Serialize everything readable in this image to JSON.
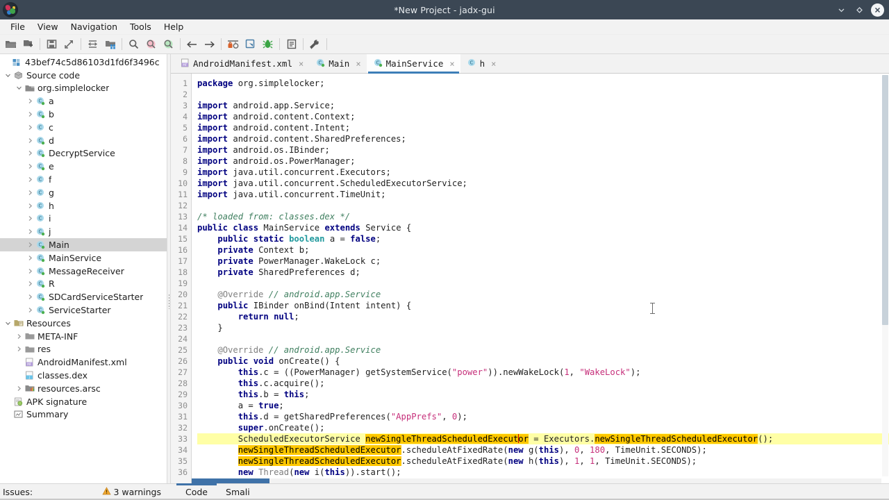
{
  "window": {
    "title": "*New Project - jadx-gui",
    "logo_icon": "jadx-logo-icon",
    "minimize_icon": "chevron-down-icon",
    "maximize_icon": "diamond-icon",
    "close_icon": "close-icon"
  },
  "menubar": {
    "items": [
      {
        "label": "File"
      },
      {
        "label": "View"
      },
      {
        "label": "Navigation"
      },
      {
        "label": "Tools"
      },
      {
        "label": "Help"
      }
    ]
  },
  "toolbar": {
    "items": [
      {
        "name": "open-file-icon",
        "title": "Open file"
      },
      {
        "name": "add-files-icon",
        "title": "Add files"
      },
      {
        "name": "save-all-icon",
        "title": "Save all"
      },
      {
        "name": "export-gradle-icon",
        "title": "Export gradle project"
      },
      {
        "name": "sync-icon",
        "title": "Sync"
      },
      {
        "name": "flat-packages-icon",
        "title": "Flat packages"
      },
      {
        "name": "search-icon",
        "title": "Search text"
      },
      {
        "name": "find-class-icon",
        "title": "Search class"
      },
      {
        "name": "find-comment-icon",
        "title": "Search comment"
      },
      {
        "name": "back-arrow-icon",
        "title": "Back"
      },
      {
        "name": "forward-arrow-icon",
        "title": "Forward"
      },
      {
        "name": "deobfuscation-icon",
        "title": "Deobfuscation"
      },
      {
        "name": "quark-icon",
        "title": "Quark engine"
      },
      {
        "name": "debugger-icon",
        "title": "Debugger"
      },
      {
        "name": "log-viewer-icon",
        "title": "Log viewer"
      },
      {
        "name": "preferences-icon",
        "title": "Preferences"
      }
    ]
  },
  "sidebar": {
    "tree": [
      {
        "depth": 0,
        "twisty": "none",
        "icon": "apk-icon",
        "label": "43bef74c5d86103d1fd6f3496c"
      },
      {
        "depth": 0,
        "twisty": "open",
        "icon": "package-icon",
        "label": "Source code"
      },
      {
        "depth": 1,
        "twisty": "open",
        "icon": "folder-icon",
        "label": "org.simplelocker"
      },
      {
        "depth": 2,
        "twisty": "closed",
        "icon": "class-icon",
        "label": "a"
      },
      {
        "depth": 2,
        "twisty": "closed",
        "icon": "class-icon",
        "label": "b"
      },
      {
        "depth": 2,
        "twisty": "closed",
        "icon": "class-plain-icon",
        "label": "c"
      },
      {
        "depth": 2,
        "twisty": "closed",
        "icon": "class-icon",
        "label": "d"
      },
      {
        "depth": 2,
        "twisty": "closed",
        "icon": "class-icon",
        "label": "DecryptService"
      },
      {
        "depth": 2,
        "twisty": "closed",
        "icon": "class-icon",
        "label": "e"
      },
      {
        "depth": 2,
        "twisty": "closed",
        "icon": "class-plain-icon",
        "label": "f"
      },
      {
        "depth": 2,
        "twisty": "closed",
        "icon": "class-plain-icon",
        "label": "g"
      },
      {
        "depth": 2,
        "twisty": "closed",
        "icon": "class-plain-icon",
        "label": "h"
      },
      {
        "depth": 2,
        "twisty": "closed",
        "icon": "class-plain-icon",
        "label": "i"
      },
      {
        "depth": 2,
        "twisty": "closed",
        "icon": "class-icon",
        "label": "j"
      },
      {
        "depth": 2,
        "twisty": "closed",
        "icon": "class-icon",
        "label": "Main",
        "selected": true
      },
      {
        "depth": 2,
        "twisty": "closed",
        "icon": "class-icon",
        "label": "MainService"
      },
      {
        "depth": 2,
        "twisty": "closed",
        "icon": "class-icon",
        "label": "MessageReceiver"
      },
      {
        "depth": 2,
        "twisty": "closed",
        "icon": "class-icon",
        "label": "R"
      },
      {
        "depth": 2,
        "twisty": "closed",
        "icon": "class-icon",
        "label": "SDCardServiceStarter"
      },
      {
        "depth": 2,
        "twisty": "closed",
        "icon": "class-icon",
        "label": "ServiceStarter"
      },
      {
        "depth": 0,
        "twisty": "open",
        "icon": "resources-icon",
        "label": "Resources"
      },
      {
        "depth": 1,
        "twisty": "closed",
        "icon": "folder-icon",
        "label": "META-INF"
      },
      {
        "depth": 1,
        "twisty": "closed",
        "icon": "folder-icon",
        "label": "res"
      },
      {
        "depth": 1,
        "twisty": "none",
        "icon": "manifest-icon",
        "label": "AndroidManifest.xml"
      },
      {
        "depth": 1,
        "twisty": "none",
        "icon": "dex-icon",
        "label": "classes.dex"
      },
      {
        "depth": 1,
        "twisty": "closed",
        "icon": "arsc-icon",
        "label": "resources.arsc"
      },
      {
        "depth": 0,
        "twisty": "none",
        "icon": "signature-icon",
        "label": "APK signature"
      },
      {
        "depth": 0,
        "twisty": "none",
        "icon": "summary-icon",
        "label": "Summary"
      }
    ]
  },
  "editor": {
    "tabs": [
      {
        "label": "AndroidManifest.xml",
        "icon": "manifest-icon",
        "active": false,
        "close": "×"
      },
      {
        "label": "Main",
        "icon": "class-icon",
        "active": false,
        "close": "×"
      },
      {
        "label": "MainService",
        "icon": "class-icon",
        "active": true,
        "close": "×"
      },
      {
        "label": "h",
        "icon": "class-plain-icon",
        "active": false,
        "close": "×"
      }
    ],
    "first_line": 1,
    "last_line": 36,
    "line_numbers": [
      1,
      2,
      3,
      4,
      5,
      6,
      7,
      8,
      9,
      10,
      11,
      12,
      13,
      14,
      15,
      16,
      17,
      18,
      19,
      20,
      21,
      22,
      23,
      24,
      25,
      26,
      27,
      28,
      29,
      30,
      31,
      32,
      33,
      34,
      35,
      36
    ],
    "code_lines": [
      "package org.simplelocker;",
      "",
      "import android.app.Service;",
      "import android.content.Context;",
      "import android.content.Intent;",
      "import android.content.SharedPreferences;",
      "import android.os.IBinder;",
      "import android.os.PowerManager;",
      "import java.util.concurrent.Executors;",
      "import java.util.concurrent.ScheduledExecutorService;",
      "import java.util.concurrent.TimeUnit;",
      "",
      "/* loaded from: classes.dex */",
      "public class MainService extends Service {",
      "    public static boolean a = false;",
      "    private Context b;",
      "    private PowerManager.WakeLock c;",
      "    private SharedPreferences d;",
      "",
      "    @Override // android.app.Service",
      "    public IBinder onBind(Intent intent) {",
      "        return null;",
      "    }",
      "",
      "    @Override // android.app.Service",
      "    public void onCreate() {",
      "        this.c = ((PowerManager) getSystemService(\"power\")).newWakeLock(1, \"WakeLock\");",
      "        this.c.acquire();",
      "        this.b = this;",
      "        a = true;",
      "        this.d = getSharedPreferences(\"AppPrefs\", 0);",
      "        super.onCreate();",
      "        ScheduledExecutorService newSingleThreadScheduledExecutor = Executors.newSingleThreadScheduledExecutor();",
      "        newSingleThreadScheduledExecutor.scheduleAtFixedRate(new g(this), 0, 180, TimeUnit.SECONDS);",
      "        newSingleThreadScheduledExecutor.scheduleAtFixedRate(new h(this), 1, 1, TimeUnit.SECONDS);",
      "        new Thread(new i(this)).start();"
    ],
    "highlighted_lines": [
      33
    ],
    "occurrence_token": "newSingleThreadScheduledExecutor"
  },
  "statusbar": {
    "issues_label": "Issues:",
    "warning_icon": "warning-triangle-icon",
    "warnings_text": "3 warnings",
    "tabs": [
      {
        "label": "Code",
        "active": true
      },
      {
        "label": "Smali",
        "active": false
      }
    ]
  },
  "colors": {
    "titlebar_bg": "#3b4754",
    "chrome_bg": "#f2f2f2",
    "accent_blue": "#3f72a8",
    "keyword": "#000080",
    "type": "#20999d",
    "comment": "#3f7f5f",
    "string": "#c62f7a",
    "highlight_line": "#ffffa6",
    "occurrence": "#ffc800",
    "selection": "#d4d4d4"
  }
}
